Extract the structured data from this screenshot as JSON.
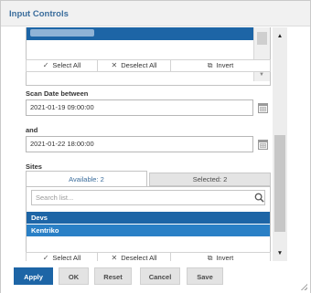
{
  "dialog": {
    "title": "Input Controls"
  },
  "top_list": {
    "actions": {
      "select_all": "Select All",
      "deselect_all": "Deselect All",
      "invert": "Invert"
    }
  },
  "scan_date": {
    "label": "Scan Date between",
    "start_value": "2021-01-19 09:00:00",
    "and_label": "and",
    "end_value": "2021-01-22 18:00:00"
  },
  "sites": {
    "label": "Sites",
    "tab_available": "Available: 2",
    "tab_selected": "Selected: 2",
    "search_placeholder": "Search list...",
    "items": [
      {
        "label": "Devs"
      },
      {
        "label": "Kentriko"
      }
    ],
    "actions": {
      "select_all": "Select All",
      "deselect_all": "Deselect All",
      "invert": "Invert"
    }
  },
  "buttons": {
    "apply": "Apply",
    "ok": "OK",
    "reset": "Reset",
    "cancel": "Cancel",
    "save": "Save"
  },
  "colors": {
    "title": "#3b6d9c",
    "selection": "#1d65a6",
    "primary_button": "#1d65a6"
  },
  "icons": {
    "select_all": "check-icon",
    "deselect_all": "x-icon",
    "invert": "invert-icon",
    "calendar": "calendar-icon",
    "search": "search-icon"
  }
}
